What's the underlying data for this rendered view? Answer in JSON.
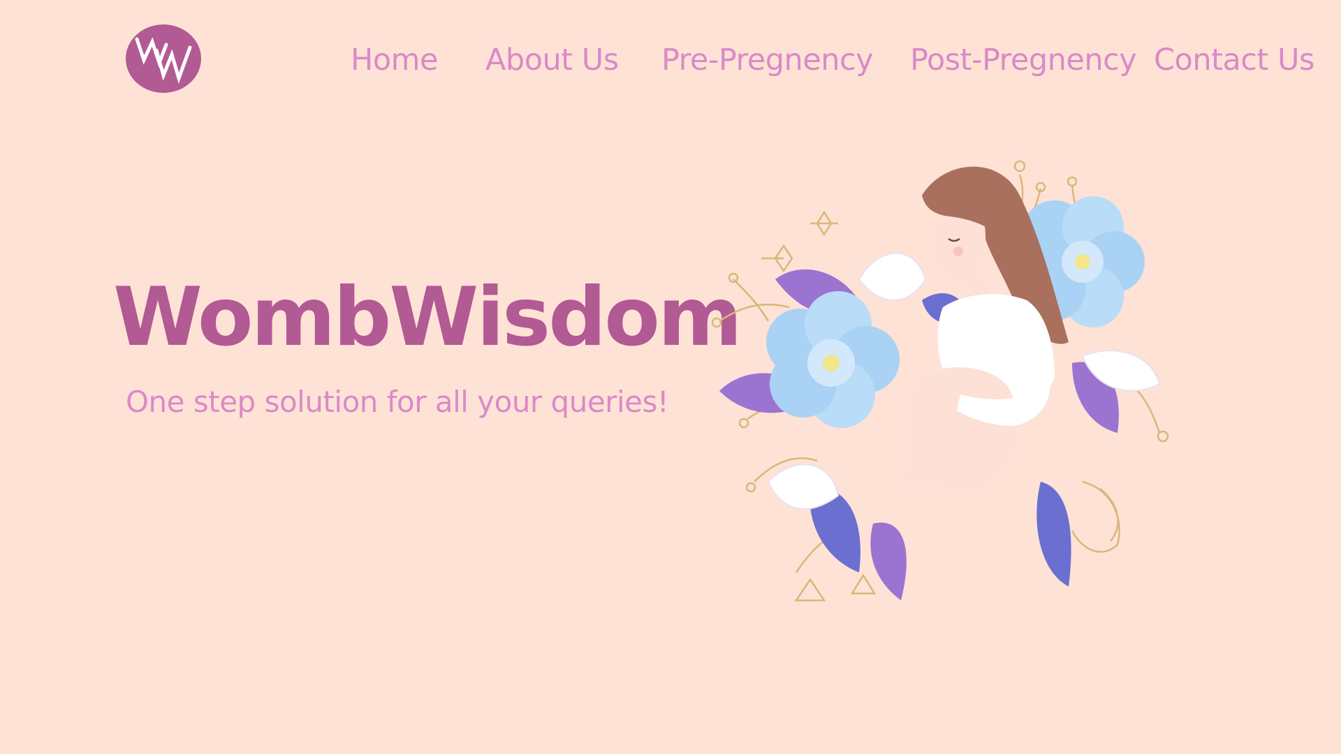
{
  "brand": {
    "logo_text": "WW",
    "logo_color": "#b25a94"
  },
  "nav": {
    "items": [
      {
        "label": "Home"
      },
      {
        "label": "About Us"
      },
      {
        "label": "Pre-Pregnency"
      },
      {
        "label": "Post-Pregnency"
      },
      {
        "label": "Contact Us"
      }
    ]
  },
  "hero": {
    "title": "WombWisdom",
    "subtitle": "One step solution for all your queries!"
  },
  "colors": {
    "background": "#ffe2d6",
    "title": "#b25a94",
    "nav_text": "#d98ac8",
    "flower_blue": "#a9d2f5",
    "leaf_purple": "#9b73d1",
    "leaf_indigo": "#6a6fd0",
    "hair": "#a8705d",
    "skin": "#fde0d6",
    "dress": "#ffffff",
    "gold_lines": "#d8b879"
  },
  "illustration": {
    "icon": "pregnant-woman-floral-illustration"
  }
}
